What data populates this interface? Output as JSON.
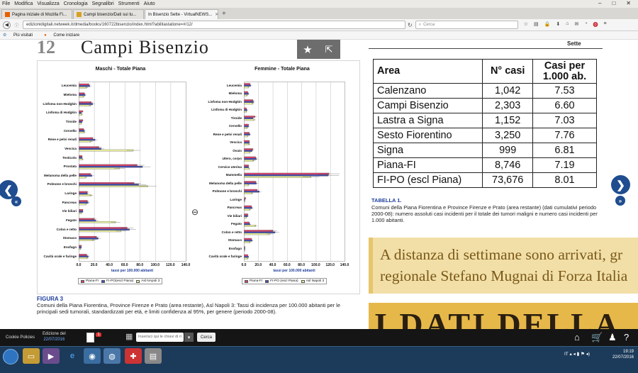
{
  "browser": {
    "menu": [
      "File",
      "Modifica",
      "Visualizza",
      "Cronologia",
      "Segnalibri",
      "Strumenti",
      "Aiuto"
    ],
    "tabs": [
      {
        "label": "Pagina iniziale di Mozilla Fi..."
      },
      {
        "label": "Campi bisenzio/Dati sui tu..."
      },
      {
        "label": "In Bisenzio Sette - VirtualNEWS..."
      }
    ],
    "url": "edizionidigitali.netweek.it/dmedia/books/160722bisenzio/index.html?abilitastatione=#/12/",
    "search_placeholder": "Cerca",
    "bookmarks": [
      "Più visitati",
      "Come iniziare"
    ]
  },
  "page": {
    "chapter_number": "12",
    "chapter_title": "Campi Bisenzio",
    "top_right": "Sette",
    "figure_label": "FIGURA 3",
    "figure_caption": "Comuni della Piana Fiorentina, Province Firenze e Prato (area restante), Asl Napoli 3: Tassi di incidenza per 100.000 abitanti per le principali sedi tumorali, standardizzati per età, e limiti confidenza al 95%, per genere (periodo 2000-08).",
    "table_label": "TABELLA 1.",
    "table_caption": "Comuni della Piana Fiorentina e Province Firenze e Prato (area restante) (dati cumulativi periodo 2000-08): numero assoluti casi incidenti per il totale dei tumori maligni e numero casi incidenti per 1.000 abitanti.",
    "quote_line1": "A distanza di settimane sono arrivati, gr",
    "quote_line2": "regionale Stefano Mugnai di Forza Italia",
    "big_text": "I DATI DELLA"
  },
  "table": {
    "headers": [
      "Area",
      "N° casi",
      "Casi per 1.000 ab."
    ],
    "rows": [
      [
        "Calenzano",
        "1,042",
        "7.53"
      ],
      [
        "Campi Bisenzio",
        "2,303",
        "6.60"
      ],
      [
        "Lastra a Signa",
        "1,152",
        "7.03"
      ],
      [
        "Sesto Fiorentino",
        "3,250",
        "7.76"
      ],
      [
        "Signa",
        "999",
        "6.81"
      ],
      [
        "Piana-FI",
        "8,746",
        "7.19"
      ],
      [
        "FI-PO (escl Piana)",
        "73,676",
        "8.01"
      ]
    ]
  },
  "chart_data": [
    {
      "type": "bar",
      "title": "Maschi - Totale Piana",
      "xlabel": "tassi per 100.000 abitanti",
      "xlim": [
        0,
        140
      ],
      "ticks": [
        "0.0",
        "20.0",
        "40.0",
        "60.0",
        "80.0",
        "100.0",
        "120.0",
        "140.0"
      ],
      "categories": [
        "Leucemia",
        "Mieloma",
        "Linfoma non-Hodgkin",
        "Linfoma di Hodgkin",
        "Tiroide",
        "Cervello",
        "Rene e pelvi renali",
        "Vescica",
        "Testicolo",
        "Prostata",
        "Melanoma della pelle",
        "Polmone e bronchi",
        "Laringe",
        "Pancreas",
        "Vie biliari",
        "Fegato",
        "Colon e retto",
        "Stomaco",
        "Esofago",
        "Cavità orale e faringe"
      ],
      "series": [
        {
          "name": "Piana-FI",
          "color": "#d9446a",
          "values": [
            13,
            7,
            16,
            5,
            5,
            6,
            18,
            26,
            4,
            76,
            15,
            72,
            11,
            11,
            5,
            20,
            63,
            23,
            3,
            10
          ]
        },
        {
          "name": "FI-PO(escl Piana)",
          "color": "#4450b8",
          "values": [
            14,
            8,
            18,
            3,
            4,
            7,
            21,
            29,
            4,
            83,
            17,
            78,
            11,
            12,
            5,
            22,
            66,
            25,
            3,
            12
          ]
        },
        {
          "name": "Asl NApoli 3",
          "color": "#e8ee9c",
          "values": [
            10,
            6,
            15,
            4,
            3,
            7,
            16,
            71,
            5,
            53,
            9,
            90,
            16,
            9,
            3,
            48,
            55,
            19,
            2,
            11
          ]
        }
      ]
    },
    {
      "type": "bar",
      "title": "Femmine - Totale Piana",
      "xlabel": "tassi per 100.000 abitanti",
      "xlim": [
        0,
        140
      ],
      "ticks": [
        "0.0",
        "20.0",
        "40.0",
        "60.0",
        "80.0",
        "100.0",
        "120.0",
        "140.0"
      ],
      "categories": [
        "Leucemia",
        "Mieloma",
        "Linfoma non-Hodgkin",
        "Linfoma di Hodgkin",
        "Tiroide",
        "Cervello",
        "Rene e pelvi renali",
        "Vescica",
        "Ovaio",
        "Utero, corpo",
        "Cervice uterina",
        "Mammella",
        "Melanoma della pelle",
        "Polmone e bronchi",
        "Laringe",
        "Pancreas",
        "Vie biliari",
        "Fegato",
        "Colon e retto",
        "Stomaco",
        "Esofago",
        "Cavità orale e faringe"
      ],
      "series": [
        {
          "name": "Piana-FI",
          "color": "#d9446a",
          "values": [
            8,
            5,
            12,
            3,
            15,
            6,
            7,
            7,
            12,
            16,
            6,
            118,
            16,
            18,
            2,
            10,
            5,
            7,
            40,
            10,
            1,
            5
          ]
        },
        {
          "name": "FI-PO (escl Piana)",
          "color": "#4450b8",
          "values": [
            9,
            6,
            13,
            4,
            12,
            6,
            8,
            7,
            11,
            17,
            6,
            117,
            17,
            21,
            1,
            11,
            5,
            8,
            43,
            11,
            1,
            6
          ]
        },
        {
          "name": "Asl Napoli 3",
          "color": "#e8ee9c",
          "values": [
            6,
            4,
            12,
            3,
            14,
            4,
            5,
            7,
            8,
            13,
            7,
            93,
            6,
            11,
            1,
            8,
            3,
            16,
            36,
            8,
            1,
            5
          ]
        }
      ]
    }
  ],
  "app": {
    "cookie": "Cookie Policies",
    "edition_label": "Edizione del",
    "edition_date": "22/07/2016",
    "page_badge": "1",
    "key_placeholder": "Inserisci qui le chiavi di ri",
    "search_btn": "Cerca"
  },
  "taskbar": {
    "lang": "IT",
    "time": "19:19",
    "date": "22/07/2016"
  },
  "colors": {
    "accent": "#1f4d8f",
    "quote_bg": "#f1dfa7",
    "band_bg": "#e6b84a"
  }
}
